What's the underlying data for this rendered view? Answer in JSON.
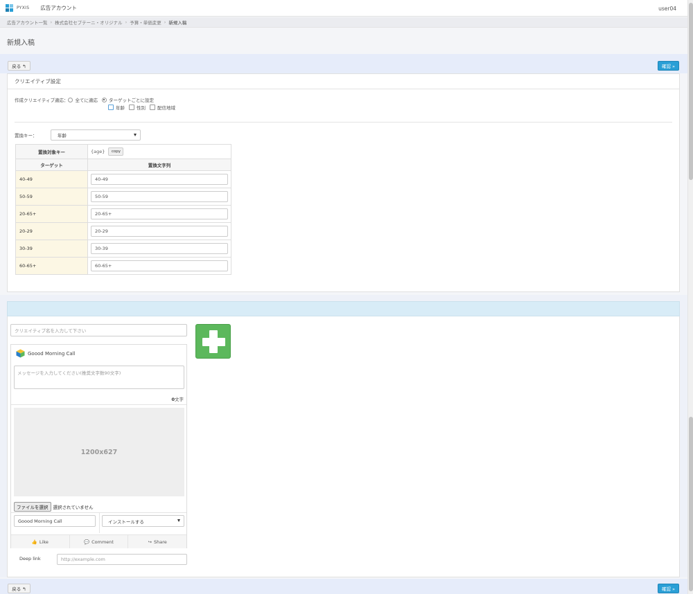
{
  "app": {
    "logo_text": "PYXIS",
    "nav_label": "広告アカウント",
    "user": "user04"
  },
  "breadcrumb": [
    "広告アカウント一覧",
    "株式会社セプテーニ・オリジナル",
    "予算・単価変更",
    "新規入稿"
  ],
  "page_title": "新規入稿",
  "buttons": {
    "back": "戻る ↰",
    "confirm": "確認 »"
  },
  "creative_settings": {
    "title": "クリエイティブ設定",
    "apply_label": "作成クリエイティブ適応：",
    "apply_all": "全てに適応",
    "apply_per_target": "ターゲットごとに設定",
    "apply_selected": "per_target",
    "targets": [
      "年齢",
      "性別",
      "配信地域"
    ],
    "replace_key_label": "置換キー：",
    "replace_key_value": "年齢",
    "table": {
      "key_header": "置換対象キー",
      "key_value": "{age}",
      "copy_label": "copy",
      "col_target": "ターゲット",
      "col_replacement": "置換文字列",
      "rows": [
        {
          "target": "40-49",
          "value": "40-49"
        },
        {
          "target": "50-59",
          "value": "50-59"
        },
        {
          "target": "20-65+",
          "value": "20-65+"
        },
        {
          "target": "20-29",
          "value": "20-29"
        },
        {
          "target": "30-39",
          "value": "30-39"
        },
        {
          "target": "60-65+",
          "value": "60-65+"
        }
      ]
    }
  },
  "creative": {
    "name_placeholder": "クリエイティブ名を入力して下さい",
    "app_name": "Goood Morning Call",
    "message_placeholder": "メッセージを入力してください(推奨文字数90文字)",
    "char_count": "0",
    "char_unit": "文字",
    "image_size": "1200x627",
    "file_button": "ファイルを選択",
    "file_status": "選択されていません",
    "headline_value": "Goood Morning Call",
    "cta_value": "インストールする",
    "social": {
      "like": "Like",
      "comment": "Comment",
      "share": "Share"
    },
    "deep_link_label": "Deep link",
    "deep_link_placeholder": "http://example.com"
  },
  "colors": {
    "accent": "#2a9fd6",
    "band": "#e6ecfa",
    "target_cell": "#fcf7e4",
    "add_button": "#5cb85c"
  }
}
